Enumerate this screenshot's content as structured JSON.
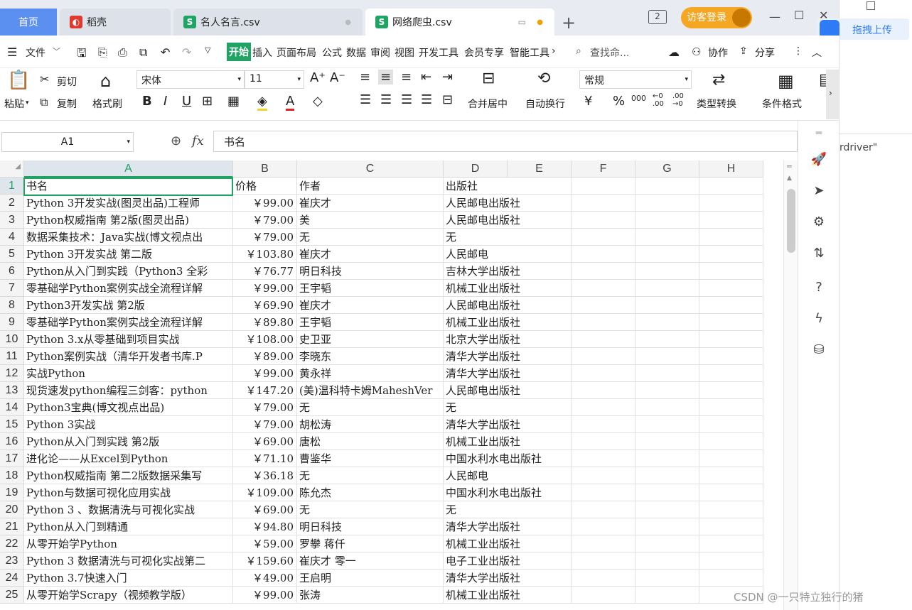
{
  "tabs": {
    "home": "首页",
    "doc1": "稻壳",
    "doc2": "名人名言.csv",
    "doc3": "网络爬虫.csv",
    "new_tab": "+"
  },
  "titlebar": {
    "badge": "2",
    "login": "访客登录",
    "minimize": "—",
    "maximize": "☐",
    "close": "✕"
  },
  "side_app": {
    "upload": "拖拽上传",
    "text": "rdriver\""
  },
  "menubar": {
    "file": "文件",
    "items": [
      "开始",
      "插入",
      "页面布局",
      "公式",
      "数据",
      "审阅",
      "视图",
      "开发工具",
      "会员专享",
      "智能工具"
    ],
    "search": "查找命...",
    "collab": "协作",
    "share": "分享"
  },
  "ribbon": {
    "paste": "粘贴",
    "cut": "剪切",
    "copy": "复制",
    "format_painter": "格式刷",
    "font": "宋体",
    "size": "11",
    "merge": "合并居中",
    "wrap": "自动换行",
    "num_format": "常规",
    "type_convert": "类型转换",
    "cond_format": "条件格式"
  },
  "formula": {
    "cell_ref": "A1",
    "fx": "fx",
    "content": "书名"
  },
  "columns": [
    "A",
    "B",
    "C",
    "D",
    "E",
    "F",
    "G",
    "H"
  ],
  "rows": [
    {
      "n": "1",
      "a": "书名",
      "b": "价格",
      "c": "作者",
      "d": "出版社",
      "hdr": true
    },
    {
      "n": "2",
      "a": "Python 3开发实战(图灵出品)工程师",
      "b": "￥99.00",
      "c": "崔庆才",
      "d": "人民邮电出版社"
    },
    {
      "n": "3",
      "a": "Python权威指南 第2版(图灵出品)",
      "b": "￥79.00",
      "c": "美",
      "d": "人民邮电出版社"
    },
    {
      "n": "4",
      "a": "数据采集技术：Java实战(博文视点出",
      "b": "￥79.00",
      "c": "无",
      "d": "无"
    },
    {
      "n": "5",
      "a": "Python 3开发实战 第二版",
      "b": "￥103.80",
      "c": "崔庆才",
      "d": "人民邮电"
    },
    {
      "n": "6",
      "a": "Python从入门到实践（Python3 全彩",
      "b": "￥76.77",
      "c": "明日科技",
      "d": "吉林大学出版社"
    },
    {
      "n": "7",
      "a": "零基础学Python案例实战全流程详解",
      "b": "￥99.00",
      "c": "王宇韬",
      "d": "机械工业出版社"
    },
    {
      "n": "8",
      "a": "Python3开发实战 第2版",
      "b": "￥69.90",
      "c": "崔庆才",
      "d": "人民邮电出版社"
    },
    {
      "n": "9",
      "a": "零基础学Python案例实战全流程详解",
      "b": "￥89.80",
      "c": "王宇韬",
      "d": "机械工业出版社"
    },
    {
      "n": "10",
      "a": "Python 3.x从零基础到项目实战",
      "b": "￥108.00",
      "c": "史卫亚",
      "d": "北京大学出版社"
    },
    {
      "n": "11",
      "a": "Python案例实战（清华开发者书库.P",
      "b": "￥89.00",
      "c": "李晓东",
      "d": "清华大学出版社"
    },
    {
      "n": "12",
      "a": "实战Python",
      "b": "￥99.00",
      "c": "黄永祥",
      "d": "清华大学出版社"
    },
    {
      "n": "13",
      "a": "现货速发python编程三剑客：python",
      "b": "￥147.20",
      "c": "(美)温科特卡姆MaheshVer",
      "d": "人民邮电出版社"
    },
    {
      "n": "14",
      "a": "Python3宝典(博文视点出品)",
      "b": "￥79.00",
      "c": "无",
      "d": "无"
    },
    {
      "n": "15",
      "a": "Python 3实战",
      "b": "￥79.00",
      "c": "胡松涛",
      "d": "清华大学出版社"
    },
    {
      "n": "16",
      "a": "Python从入门到实践 第2版",
      "b": "￥69.00",
      "c": "唐松",
      "d": "机械工业出版社"
    },
    {
      "n": "17",
      "a": "进化论——从Excel到Python",
      "b": "￥71.10",
      "c": "曹鉴华",
      "d": "中国水利水电出版社"
    },
    {
      "n": "18",
      "a": "Python权威指南 第二2版数据采集写",
      "b": "￥36.18",
      "c": "无",
      "d": "人民邮电"
    },
    {
      "n": "19",
      "a": "Python与数据可视化应用实战",
      "b": "￥109.00",
      "c": "陈允杰",
      "d": "中国水利水电出版社"
    },
    {
      "n": "20",
      "a": "Python 3 、数据清洗与可视化实战",
      "b": "￥69.00",
      "c": "无",
      "d": "无"
    },
    {
      "n": "21",
      "a": "Python从入门到精通",
      "b": "￥94.80",
      "c": "明日科技",
      "d": "清华大学出版社"
    },
    {
      "n": "22",
      "a": "从零开始学Python",
      "b": "￥59.00",
      "c": "罗攀 蒋仟",
      "d": "机械工业出版社"
    },
    {
      "n": "23",
      "a": "Python 3 数据清洗与可视化实战第二",
      "b": "￥159.60",
      "c": "崔庆才 零一",
      "d": "电子工业出版社"
    },
    {
      "n": "24",
      "a": "Python 3.7快速入门",
      "b": "￥49.00",
      "c": "王启明",
      "d": "清华大学出版社"
    },
    {
      "n": "25",
      "a": "从零开始学Scrapy（视频教学版）",
      "b": "￥99.00",
      "c": "张涛",
      "d": "机械工业出版社"
    }
  ],
  "watermark": "CSDN @一只特立独行的猪"
}
